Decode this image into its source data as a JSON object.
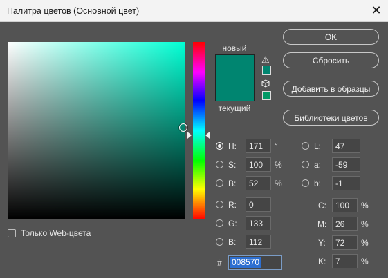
{
  "window": {
    "title": "Палитра цветов (Основной цвет)",
    "close_glyph": "✕"
  },
  "preview": {
    "new_label": "новый",
    "current_label": "текущий",
    "new_color": "#008570",
    "current_color": "#008570"
  },
  "buttons": {
    "ok": "OK",
    "reset": "Сбросить",
    "add_to_swatches": "Добавить в образцы",
    "color_libraries": "Библиотеки цветов"
  },
  "hsb": {
    "h": {
      "label": "H:",
      "value": "171",
      "unit": "°"
    },
    "s": {
      "label": "S:",
      "value": "100",
      "unit": "%"
    },
    "b": {
      "label": "B:",
      "value": "52",
      "unit": "%"
    }
  },
  "rgb": {
    "r": {
      "label": "R:",
      "value": "0"
    },
    "g": {
      "label": "G:",
      "value": "133"
    },
    "b": {
      "label": "B:",
      "value": "112"
    }
  },
  "lab": {
    "l": {
      "label": "L:",
      "value": "47"
    },
    "a": {
      "label": "a:",
      "value": "-59"
    },
    "b": {
      "label": "b:",
      "value": "-1"
    }
  },
  "cmyk": {
    "c": {
      "label": "C:",
      "value": "100",
      "unit": "%"
    },
    "m": {
      "label": "M:",
      "value": "26",
      "unit": "%"
    },
    "y": {
      "label": "Y:",
      "value": "72",
      "unit": "%"
    },
    "k": {
      "label": "K:",
      "value": "7",
      "unit": "%"
    }
  },
  "hex": {
    "label": "#",
    "value": "008570"
  },
  "web_only": {
    "label": "Только Web-цвета",
    "checked": false
  },
  "selected_mode": "H",
  "icons": {
    "gamut_warning": "warning-triangle-icon",
    "web_safe_warning": "cube-icon"
  },
  "colors": {
    "background": "#535353",
    "accent_selection": "#2d6fd1",
    "hue_field": "#00ffd4"
  }
}
